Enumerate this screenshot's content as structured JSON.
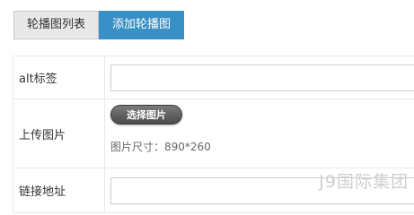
{
  "tabs": {
    "list_label": "轮播图列表",
    "add_label": "添加轮播图"
  },
  "form": {
    "alt_label": "alt标签",
    "alt_value": "",
    "upload_label": "上传图片",
    "upload_button": "选择图片",
    "size_note": "图片尺寸：890*260",
    "link_label": "链接地址",
    "link_value": ""
  },
  "watermark": "J9国际集团",
  "colors": {
    "accent": "#3990c6",
    "tab_inactive": "#e8e8e8",
    "button_dark": "#5a5a5a"
  }
}
